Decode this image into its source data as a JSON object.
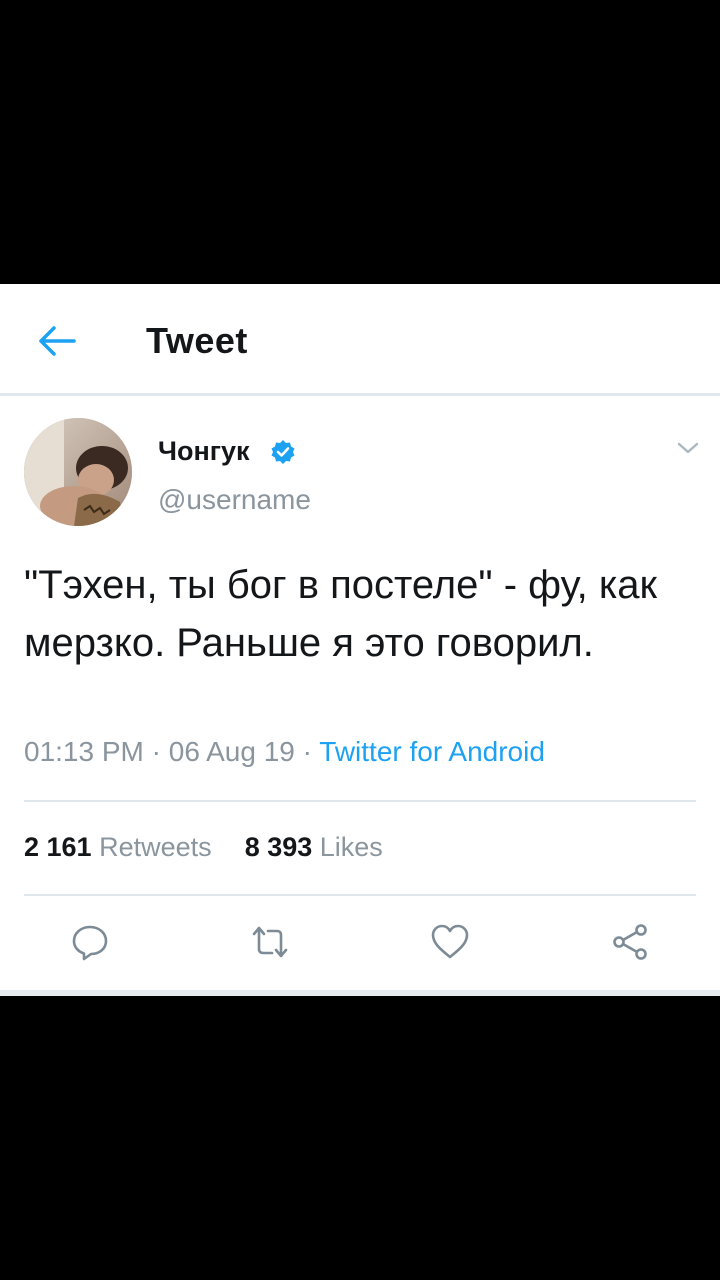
{
  "header": {
    "title": "Tweet",
    "back_icon": "arrow-left-icon"
  },
  "tweet": {
    "author_name": "Чонгук",
    "verified": true,
    "handle": "@username",
    "text": "\"Тэхен, ты бог в постеле\" - фу, как мерзко. Раньше я это говорил.",
    "time": "01:13 PM",
    "date": "06 Aug 19",
    "separator": "·",
    "source": "Twitter for Android",
    "retweets_count": "2 161",
    "retweets_label": "Retweets",
    "likes_count": "8 393",
    "likes_label": "Likes"
  },
  "actions": [
    {
      "icon": "reply-icon"
    },
    {
      "icon": "retweet-icon"
    },
    {
      "icon": "heart-icon"
    },
    {
      "icon": "share-icon"
    }
  ],
  "colors": {
    "accent": "#1da1f2",
    "text": "#14171a",
    "muted": "#8a959e",
    "divider": "#e1e8ed"
  }
}
